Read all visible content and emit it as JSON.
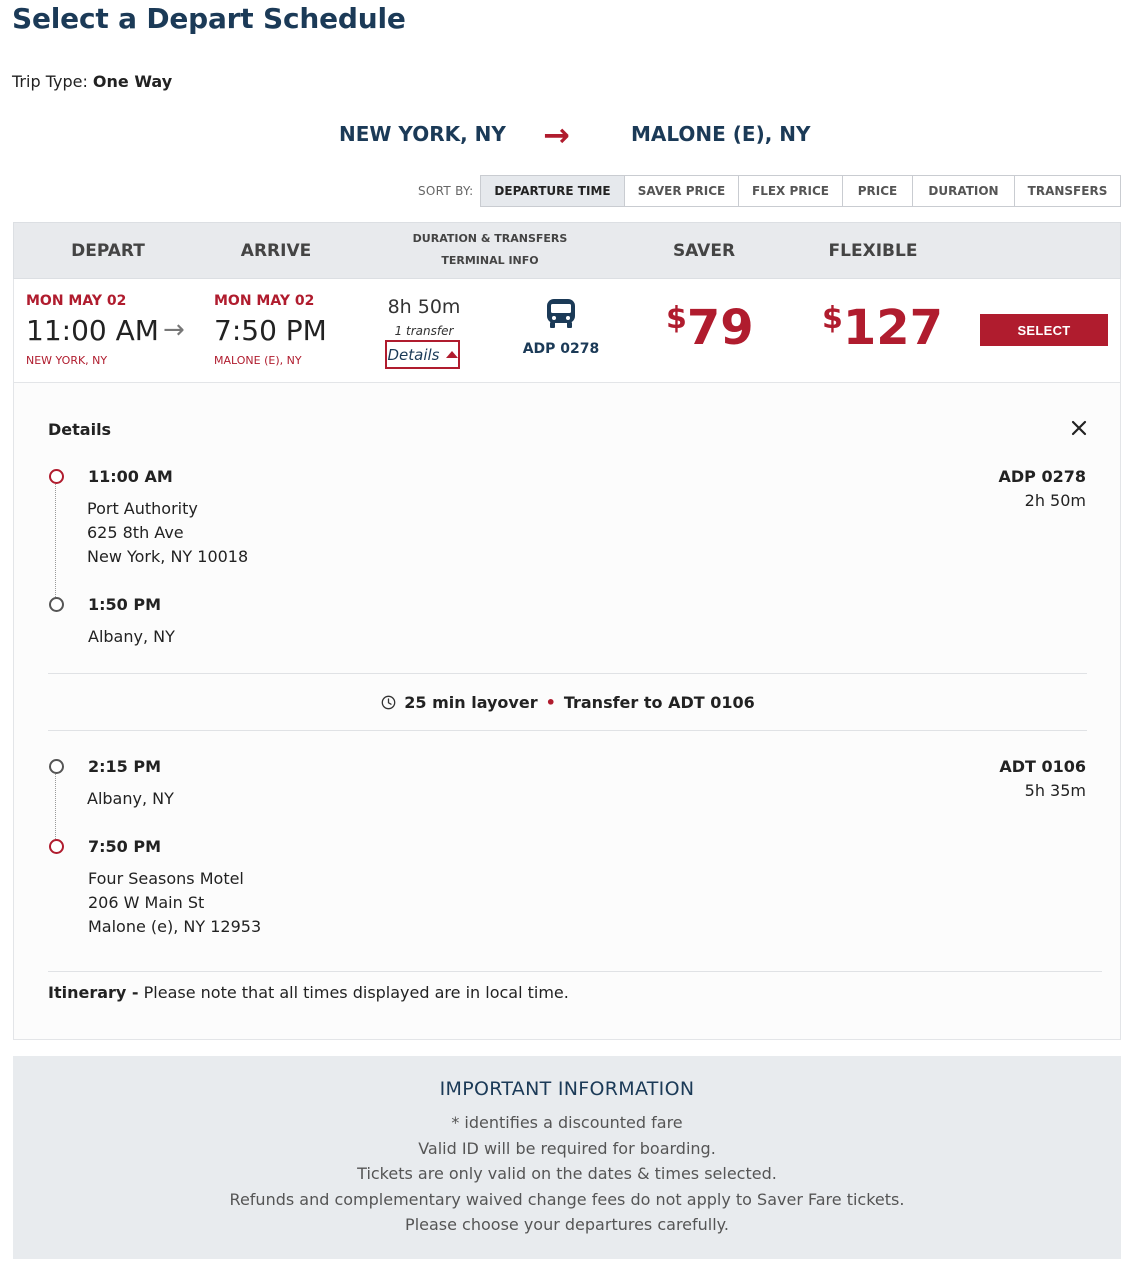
{
  "page": {
    "title": "Select a Depart Schedule",
    "trip_type_label": "Trip Type:",
    "trip_type_value": "One Way"
  },
  "route": {
    "from": "NEW YORK, NY",
    "to": "MALONE (E), NY",
    "arrow": "→"
  },
  "sort": {
    "label": "SORT BY:",
    "options": [
      "DEPARTURE TIME",
      "SAVER PRICE",
      "FLEX PRICE",
      "PRICE",
      "DURATION",
      "TRANSFERS"
    ],
    "active": "DEPARTURE TIME"
  },
  "table_header": {
    "depart": "DEPART",
    "arrive": "ARRIVE",
    "duration_transfers": "DURATION & TRANSFERS",
    "terminal_info": "TERMINAL INFO",
    "saver": "SAVER",
    "flexible": "FLEXIBLE"
  },
  "result": {
    "depart_date": "MON MAY 02",
    "depart_time": "11:00 AM",
    "depart_city": "NEW YORK, NY",
    "arrive_date": "MON MAY 02",
    "arrive_time": "7:50 PM",
    "arrive_city": "MALONE (E), NY",
    "duration": "8h 50m",
    "transfers": "1 transfer",
    "details_label": "Details",
    "route_code": "ADP 0278",
    "saver_currency": "$",
    "saver_price": "79",
    "flex_currency": "$",
    "flex_price": "127",
    "select_label": "SELECT"
  },
  "details": {
    "heading": "Details",
    "segment1": {
      "code": "ADP 0278",
      "duration": "2h 50m",
      "depart_time": "11:00 AM",
      "depart_name": "Port Authority",
      "depart_address": "625 8th Ave",
      "depart_citystate": "New York, NY 10018",
      "arrive_time": "1:50 PM",
      "arrive_city": "Albany, NY"
    },
    "layover": {
      "duration": "25 min layover",
      "bullet": "•",
      "transfer": "Transfer to ADT 0106"
    },
    "segment2": {
      "code": "ADT 0106",
      "duration": "5h 35m",
      "depart_time": "2:15 PM",
      "depart_city": "Albany, NY",
      "arrive_time": "7:50 PM",
      "arrive_name": "Four Seasons Motel",
      "arrive_address": "206 W Main St",
      "arrive_citystate": "Malone (e), NY 12953"
    },
    "itinerary_label": "Itinerary -",
    "itinerary_note": "Please note that all times displayed are in local time."
  },
  "important": {
    "title": "IMPORTANT INFORMATION",
    "lines": [
      "* identifies a discounted fare",
      "Valid ID will be required for boarding.",
      "Tickets are only valid on the dates & times selected.",
      "Refunds and complementary waived change fees do not apply to Saver Fare tickets.",
      "Please choose your departures carefully."
    ]
  },
  "colors": {
    "brand_red": "#b01c2e",
    "navy": "#1b3a57",
    "header_gray": "#e8eaed"
  }
}
